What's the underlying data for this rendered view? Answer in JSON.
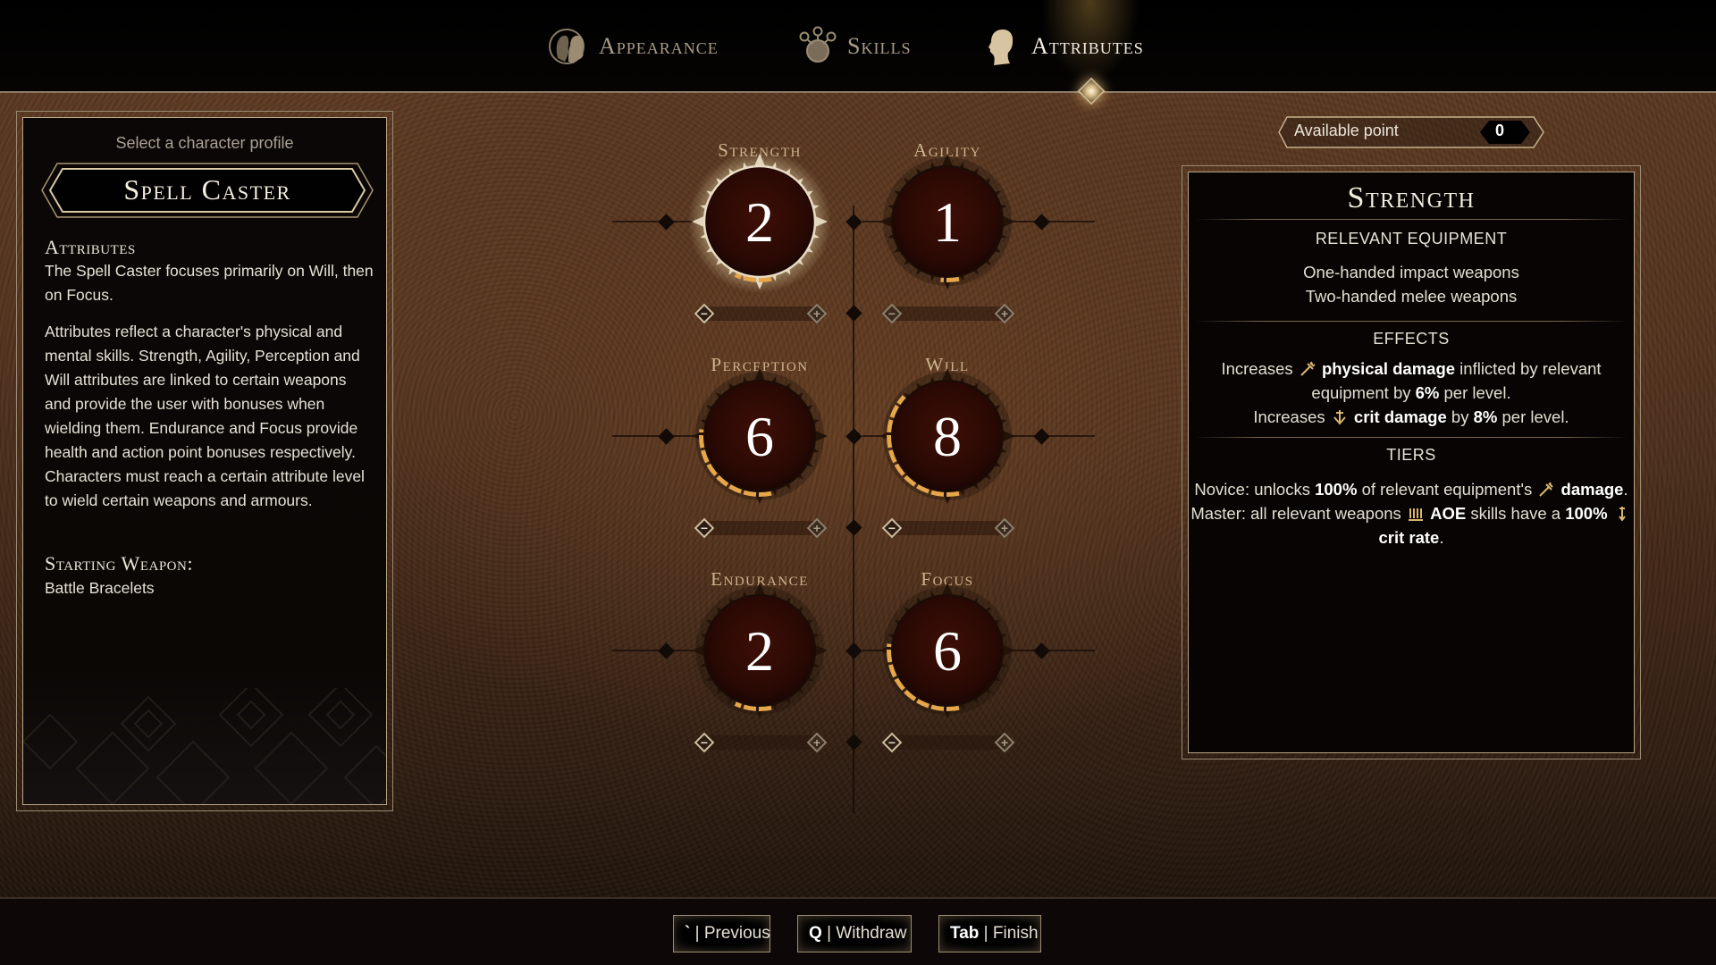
{
  "header": {
    "tabs": [
      {
        "label": "Appearance",
        "icon": "appearance-heads-icon",
        "active": false
      },
      {
        "label": "Skills",
        "icon": "skills-tree-icon",
        "active": false
      },
      {
        "label": "Attributes",
        "icon": "attributes-head-icon",
        "active": true
      }
    ]
  },
  "profile": {
    "select_label": "Select a character profile",
    "name": "Spell Caster",
    "attributes_heading": "Attributes",
    "attributes_summary": "The Spell Caster focuses primarily on Will, then on Focus.",
    "attributes_description": "Attributes reflect a character's physical and mental skills. Strength, Agility, Perception and Will attributes are linked to certain weapons and provide the user with bonuses when wielding them. Endurance and Focus provide health and action point bonuses respectively. Characters must reach a certain attribute level to wield certain weapons and armours.",
    "starting_weapon_heading": "Starting Weapon:",
    "starting_weapon": "Battle Bracelets"
  },
  "attributes": [
    {
      "name": "Strength",
      "value": "2",
      "selected": true,
      "fill_fraction": 0.1
    },
    {
      "name": "Agility",
      "value": "1",
      "selected": false,
      "fill_fraction": 0.05
    },
    {
      "name": "Perception",
      "value": "6",
      "selected": false,
      "fill_fraction": 0.3
    },
    {
      "name": "Will",
      "value": "8",
      "selected": false,
      "fill_fraction": 0.4
    },
    {
      "name": "Endurance",
      "value": "2",
      "selected": false,
      "fill_fraction": 0.1
    },
    {
      "name": "Focus",
      "value": "6",
      "selected": false,
      "fill_fraction": 0.3
    }
  ],
  "stepper": {
    "minus": "−",
    "plus": "+"
  },
  "available_points": {
    "label": "Available point",
    "value": "0"
  },
  "detail": {
    "title": "Strength",
    "equipment_heading": "RELEVANT EQUIPMENT",
    "equipment": [
      "One-handed impact weapons",
      "Two-handed melee weapons"
    ],
    "effects_heading": "EFFECTS",
    "effects": {
      "line1_a": "Increases",
      "line1_b": "physical damage",
      "line1_c": "inflicted by relevant",
      "line2_a": "equipment by",
      "line2_b": "6%",
      "line2_c": "per level.",
      "line3_a": "Increases",
      "line3_b": "crit damage",
      "line3_c": "by",
      "line3_d": "8%",
      "line3_e": "per level."
    },
    "tiers_heading": "TIERS",
    "tiers": {
      "novice_a": "Novice: unlocks",
      "novice_b": "100%",
      "novice_c": "of relevant equipment's",
      "novice_d": "damage",
      "master_a": "Master: all relevant weapons",
      "master_b": "AOE",
      "master_c": "skills have a",
      "master_d": "100%",
      "master_e": "crit rate"
    }
  },
  "footer": {
    "buttons": [
      {
        "key": "`",
        "label": "Previous"
      },
      {
        "key": "Q",
        "label": "Withdraw"
      },
      {
        "key": "Tab",
        "label": "Finish"
      }
    ],
    "separator": "|"
  }
}
